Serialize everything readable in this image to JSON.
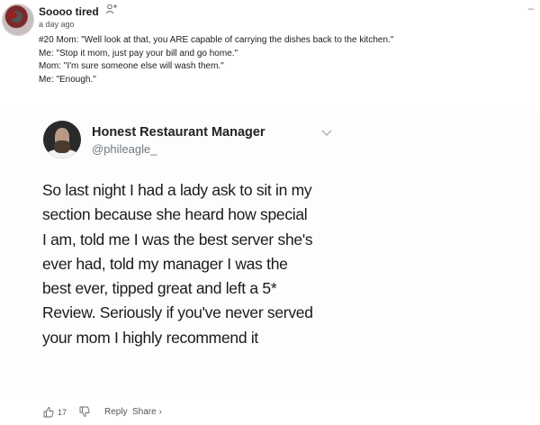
{
  "comment": {
    "username": "Soooo tired",
    "timestamp": "a day ago",
    "lines": [
      "#20 Mom: \"Well look at that, you ARE capable of carrying the dishes back to the kitchen.\"",
      "Me: \"Stop it mom, just pay your bill and go home.\"",
      "Mom: \"I'm sure someone else will wash them.\"",
      "Me: \"Enough.\""
    ]
  },
  "tweet": {
    "name": "Honest Restaurant Manager",
    "handle": "@phileagle_",
    "lines": [
      "So last night I had a lady ask to sit in my",
      "section because she heard how special",
      "I am, told me I was the best server she's",
      "ever had, told my manager I was the",
      "best ever, tipped great and left a 5*",
      "Review. Seriously if you've never served",
      "your mom I highly recommend it"
    ]
  },
  "actions": {
    "upvotes": "17",
    "reply_label": "Reply",
    "share_label": "Share ›"
  }
}
